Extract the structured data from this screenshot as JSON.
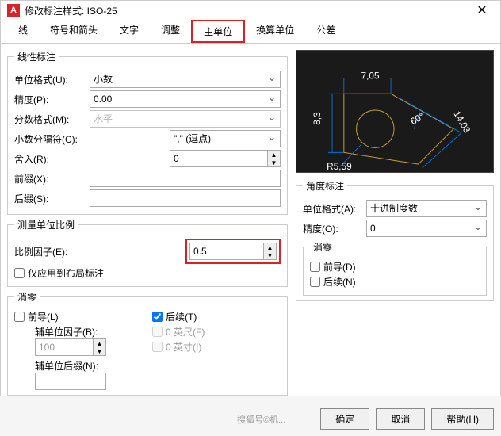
{
  "title": "修改标注样式: ISO-25",
  "tabs": {
    "t0": "线",
    "t1": "符号和箭头",
    "t2": "文字",
    "t3": "调整",
    "t4": "主单位",
    "t5": "换算单位",
    "t6": "公差"
  },
  "linear": {
    "legend": "线性标注",
    "unitFormatLabel": "单位格式(U):",
    "unitFormat": "小数",
    "precisionLabel": "精度(P):",
    "precision": "0.00",
    "fracFormatLabel": "分数格式(M):",
    "fracFormat": "水平",
    "decSepLabel": "小数分隔符(C):",
    "decSep": "\",\" (逗点)",
    "roundLabel": "舍入(R):",
    "round": "0",
    "prefixLabel": "前缀(X):",
    "prefix": "",
    "suffixLabel": "后缀(S):",
    "suffix": ""
  },
  "scale": {
    "legend": "测量单位比例",
    "factorLabel": "比例因子(E):",
    "factor": "0.5",
    "layoutOnly": "仅应用到布局标注"
  },
  "zero": {
    "legend": "消零",
    "leading": "前导(L)",
    "trailing": "后续(T)",
    "subFactorLabel": "辅单位因子(B):",
    "subFactor": "100",
    "subSuffixLabel": "辅单位后缀(N):",
    "subSuffix": "",
    "feet": "0 英尺(F)",
    "inch": "0 英寸(I)"
  },
  "angle": {
    "legend": "角度标注",
    "unitLabel": "单位格式(A):",
    "unit": "十进制度数",
    "precLabel": "精度(O):",
    "prec": "0",
    "zeroLegend": "消零",
    "leading": "前导(D)",
    "trailing": "后续(N)"
  },
  "preview": {
    "d1": "7,05",
    "d2": "8,3",
    "d3": "R5,59",
    "d4": "60°",
    "d5": "14,03"
  },
  "footer": {
    "ok": "确定",
    "cancel": "取消",
    "help": "帮助(H)",
    "watermark": "搜狐号©机..."
  }
}
